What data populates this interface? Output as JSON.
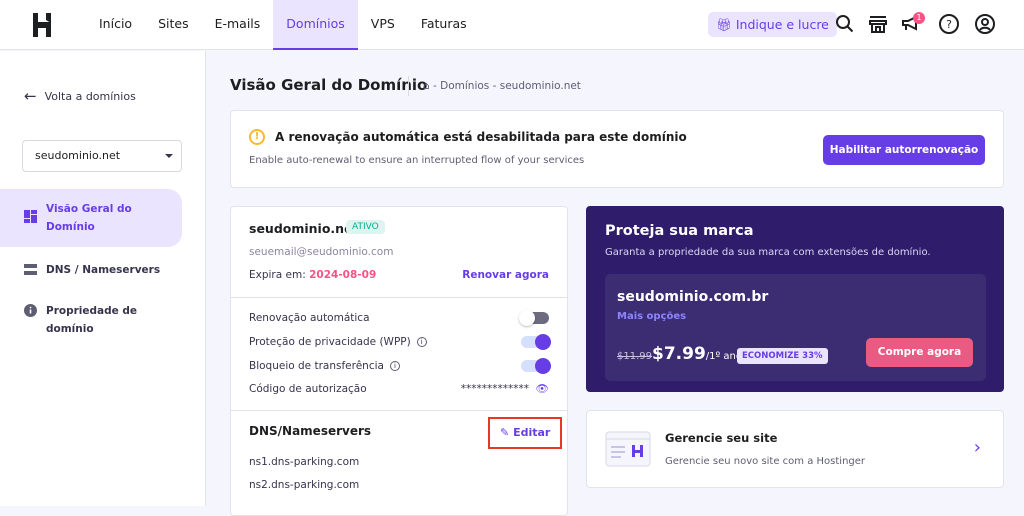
{
  "header": {
    "nav": [
      "Início",
      "Sites",
      "E-mails",
      "Domínios",
      "VPS",
      "Faturas"
    ],
    "active_nav": "Domínios",
    "referral": "Indique e lucre",
    "notification_count": "1"
  },
  "sidebar": {
    "back": "Volta a domínios",
    "domain_select": "seudominio.net",
    "items": [
      {
        "label": "Visão Geral do Domínio"
      },
      {
        "label": "DNS / Nameservers"
      },
      {
        "label": "Propriedade de domínio"
      }
    ]
  },
  "page": {
    "title": "Visão Geral do Domínio",
    "breadcrumb": "- Domínios - seudominio.net"
  },
  "alert": {
    "title": "A renovação automática está desabilitada para este domínio",
    "subtitle": "Enable auto-renewal to ensure an interrupted flow of your services",
    "button": "Habilitar autorrenovação"
  },
  "domain": {
    "name": "seudominio.net",
    "status": "ATIVO",
    "email": "seuemail@seudominio.com",
    "expires_label": "Expira em:",
    "expires": "2024-08-09",
    "renew": "Renovar agora",
    "settings": [
      {
        "label": "Renovação automática",
        "on": false
      },
      {
        "label": "Proteção de privacidade (WPP)",
        "on": true
      },
      {
        "label": "Bloqueio de transferência",
        "on": true
      }
    ],
    "auth_label": "Código de autorização",
    "auth_code": "*************",
    "dns_title": "DNS/Nameservers",
    "edit": "Editar",
    "nameservers": [
      "ns1.dns-parking.com",
      "ns2.dns-parking.com"
    ]
  },
  "promo": {
    "title": "Proteja sua marca",
    "subtitle": "Garanta a propriedade da sua marca com extensões de domínio.",
    "domain": "seudominio.com.br",
    "more": "Mais opções",
    "old_price": "$11.99",
    "price": "$7.99",
    "period": "/1º ano",
    "discount": "ECONOMIZE 33%",
    "buy": "Compre agora"
  },
  "manage": {
    "title": "Gerencie seu site",
    "subtitle": "Gerencie seu novo site com a Hostinger"
  }
}
